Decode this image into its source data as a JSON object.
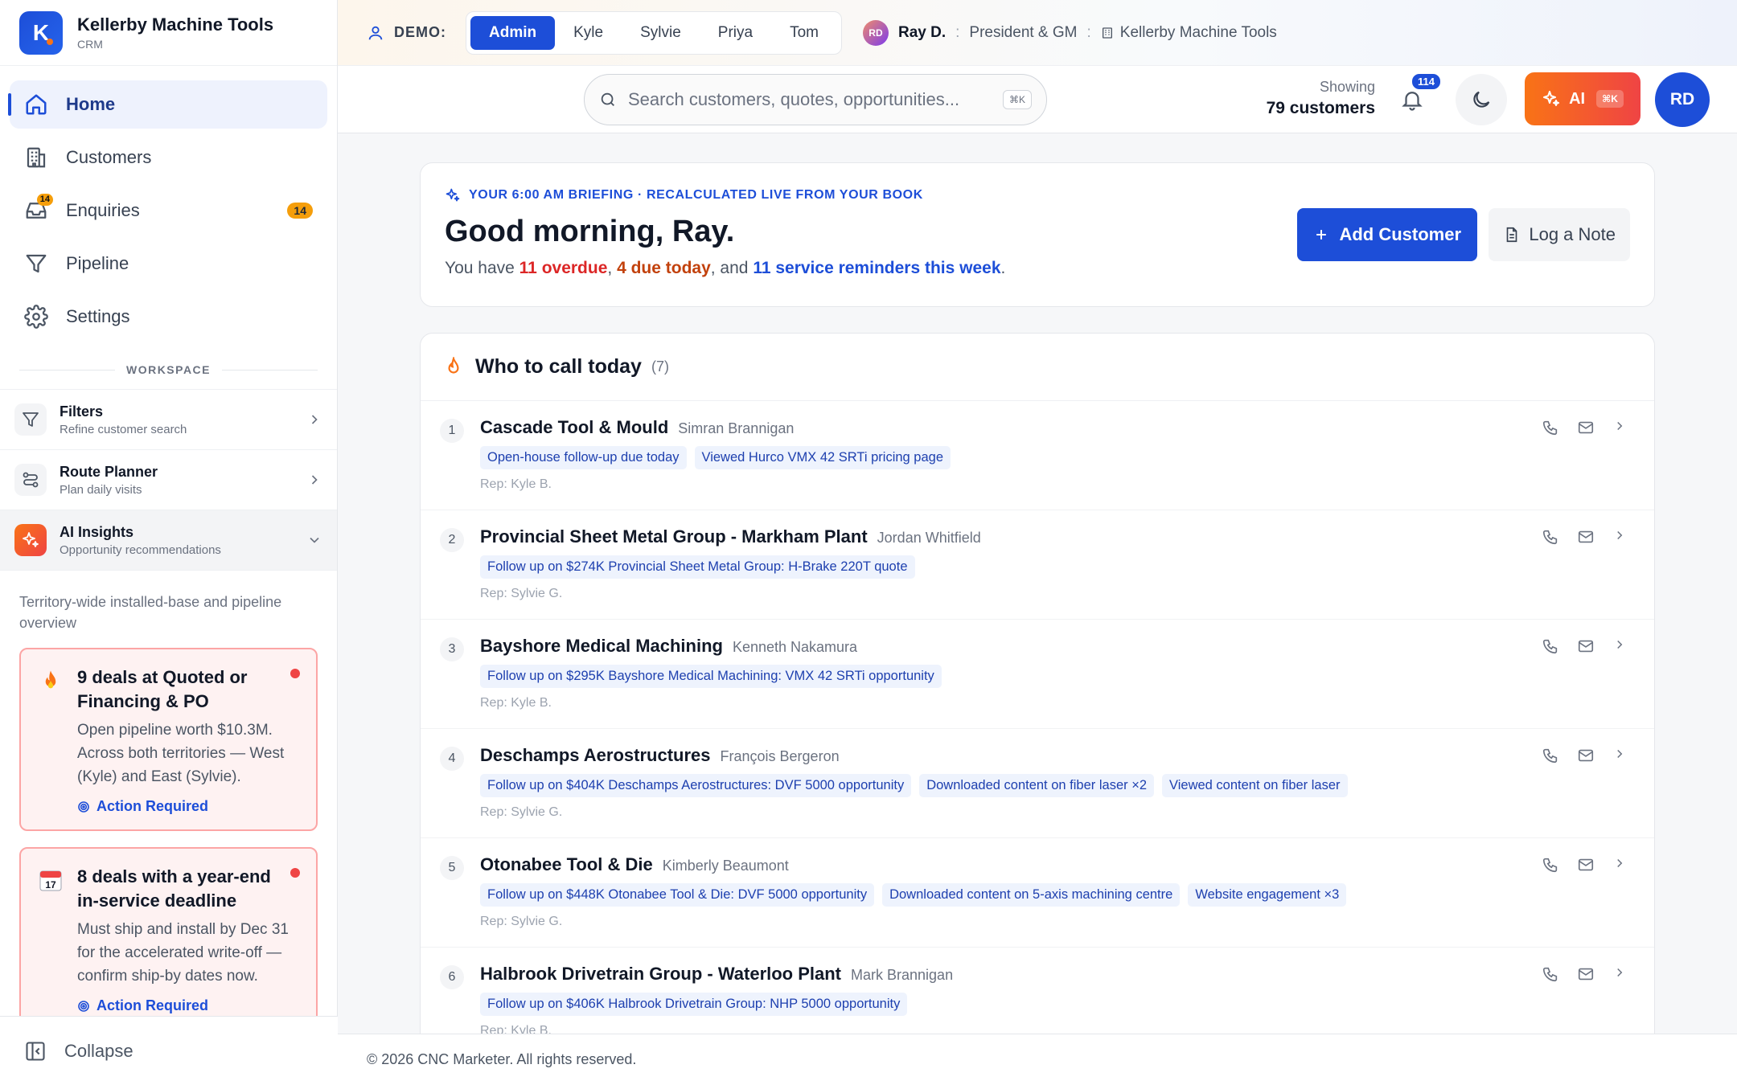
{
  "brand": {
    "logo_letter": "K",
    "name": "Kellerby Machine Tools",
    "sub": "CRM"
  },
  "nav": {
    "items": [
      {
        "label": "Home",
        "icon": "home-icon",
        "active": true
      },
      {
        "label": "Customers",
        "icon": "building-icon"
      },
      {
        "label": "Enquiries",
        "icon": "inbox-icon",
        "mini_badge": "14",
        "count": "14"
      },
      {
        "label": "Pipeline",
        "icon": "funnel-icon"
      },
      {
        "label": "Settings",
        "icon": "gear-icon"
      }
    ]
  },
  "workspace": {
    "label": "WORKSPACE",
    "items": [
      {
        "title": "Filters",
        "sub": "Refine customer search",
        "icon": "filter-icon"
      },
      {
        "title": "Route Planner",
        "sub": "Plan daily visits",
        "icon": "route-icon"
      },
      {
        "title": "AI Insights",
        "sub": "Opportunity recommendations",
        "icon": "sparkles-icon",
        "open": true
      }
    ]
  },
  "insights": {
    "intro": "Territory-wide installed-base and pipeline overview",
    "cards": [
      {
        "emoji": "fire-icon",
        "title": "9 deals at Quoted or Financing & PO",
        "body": "Open pipeline worth $10.3M. Across both territories — West (Kyle) and East (Sylvie).",
        "action": "Action Required"
      },
      {
        "emoji": "calendar-icon",
        "calendar_day": "17",
        "title": "8 deals with a year-end in-service deadline",
        "body": "Must ship and install by Dec 31 for the accelerated write-off — confirm ship-by dates now.",
        "action": "Action Required"
      }
    ]
  },
  "collapse_label": "Collapse",
  "demo": {
    "label": "DEMO:",
    "tabs": [
      "Admin",
      "Kyle",
      "Sylvie",
      "Priya",
      "Tom"
    ],
    "active_tab": "Admin",
    "user_initials": "RD",
    "user_name": "Ray D.",
    "user_role": "President & GM",
    "company": "Kellerby Machine Tools",
    "separator": ":"
  },
  "header": {
    "search_placeholder": "Search customers, quotes, opportunities...",
    "search_shortcut": "⌘K",
    "showing_label": "Showing",
    "showing_value": "79 customers",
    "notifications": "114",
    "ai_label": "AI",
    "ai_shortcut": "⌘K",
    "avatar": "RD"
  },
  "briefing": {
    "eyebrow": "YOUR 6:00 AM BRIEFING · RECALCULATED LIVE FROM YOUR BOOK",
    "title": "Good morning, Ray.",
    "line_prefix": "You have ",
    "overdue": "11 overdue",
    "comma1": ", ",
    "due_today": "4 due today",
    "and": ", and ",
    "reminders": "11 service reminders this week",
    "period": ".",
    "add_customer": "Add Customer",
    "log_note": "Log a Note"
  },
  "calls": {
    "title": "Who to call today",
    "count": "(7)",
    "rows": [
      {
        "num": "1",
        "company": "Cascade Tool & Mould",
        "contact": "Simran Brannigan",
        "tags": [
          "Open-house follow-up due today",
          "Viewed Hurco VMX 42 SRTi pricing page"
        ],
        "rep": "Rep: Kyle B."
      },
      {
        "num": "2",
        "company": "Provincial Sheet Metal Group - Markham Plant",
        "contact": "Jordan Whitfield",
        "tags": [
          "Follow up on $274K Provincial Sheet Metal Group: H-Brake 220T quote"
        ],
        "rep": "Rep: Sylvie G."
      },
      {
        "num": "3",
        "company": "Bayshore Medical Machining",
        "contact": "Kenneth Nakamura",
        "tags": [
          "Follow up on $295K Bayshore Medical Machining: VMX 42 SRTi opportunity"
        ],
        "rep": "Rep: Kyle B."
      },
      {
        "num": "4",
        "company": "Deschamps Aerostructures",
        "contact": "François Bergeron",
        "tags": [
          "Follow up on $404K Deschamps Aerostructures: DVF 5000 opportunity",
          "Downloaded content on fiber laser ×2",
          "Viewed content on fiber laser"
        ],
        "rep": "Rep: Sylvie G."
      },
      {
        "num": "5",
        "company": "Otonabee Tool & Die",
        "contact": "Kimberly Beaumont",
        "tags": [
          "Follow up on $448K Otonabee Tool & Die: DVF 5000 opportunity",
          "Downloaded content on 5-axis machining centre",
          "Website engagement ×3"
        ],
        "rep": "Rep: Sylvie G."
      },
      {
        "num": "6",
        "company": "Halbrook Drivetrain Group - Waterloo Plant",
        "contact": "Mark Brannigan",
        "tags": [
          "Follow up on $406K Halbrook Drivetrain Group: NHP 5000 opportunity"
        ],
        "rep": "Rep: Kyle B."
      }
    ]
  },
  "footer": "© 2026 CNC Marketer. All rights reserved."
}
